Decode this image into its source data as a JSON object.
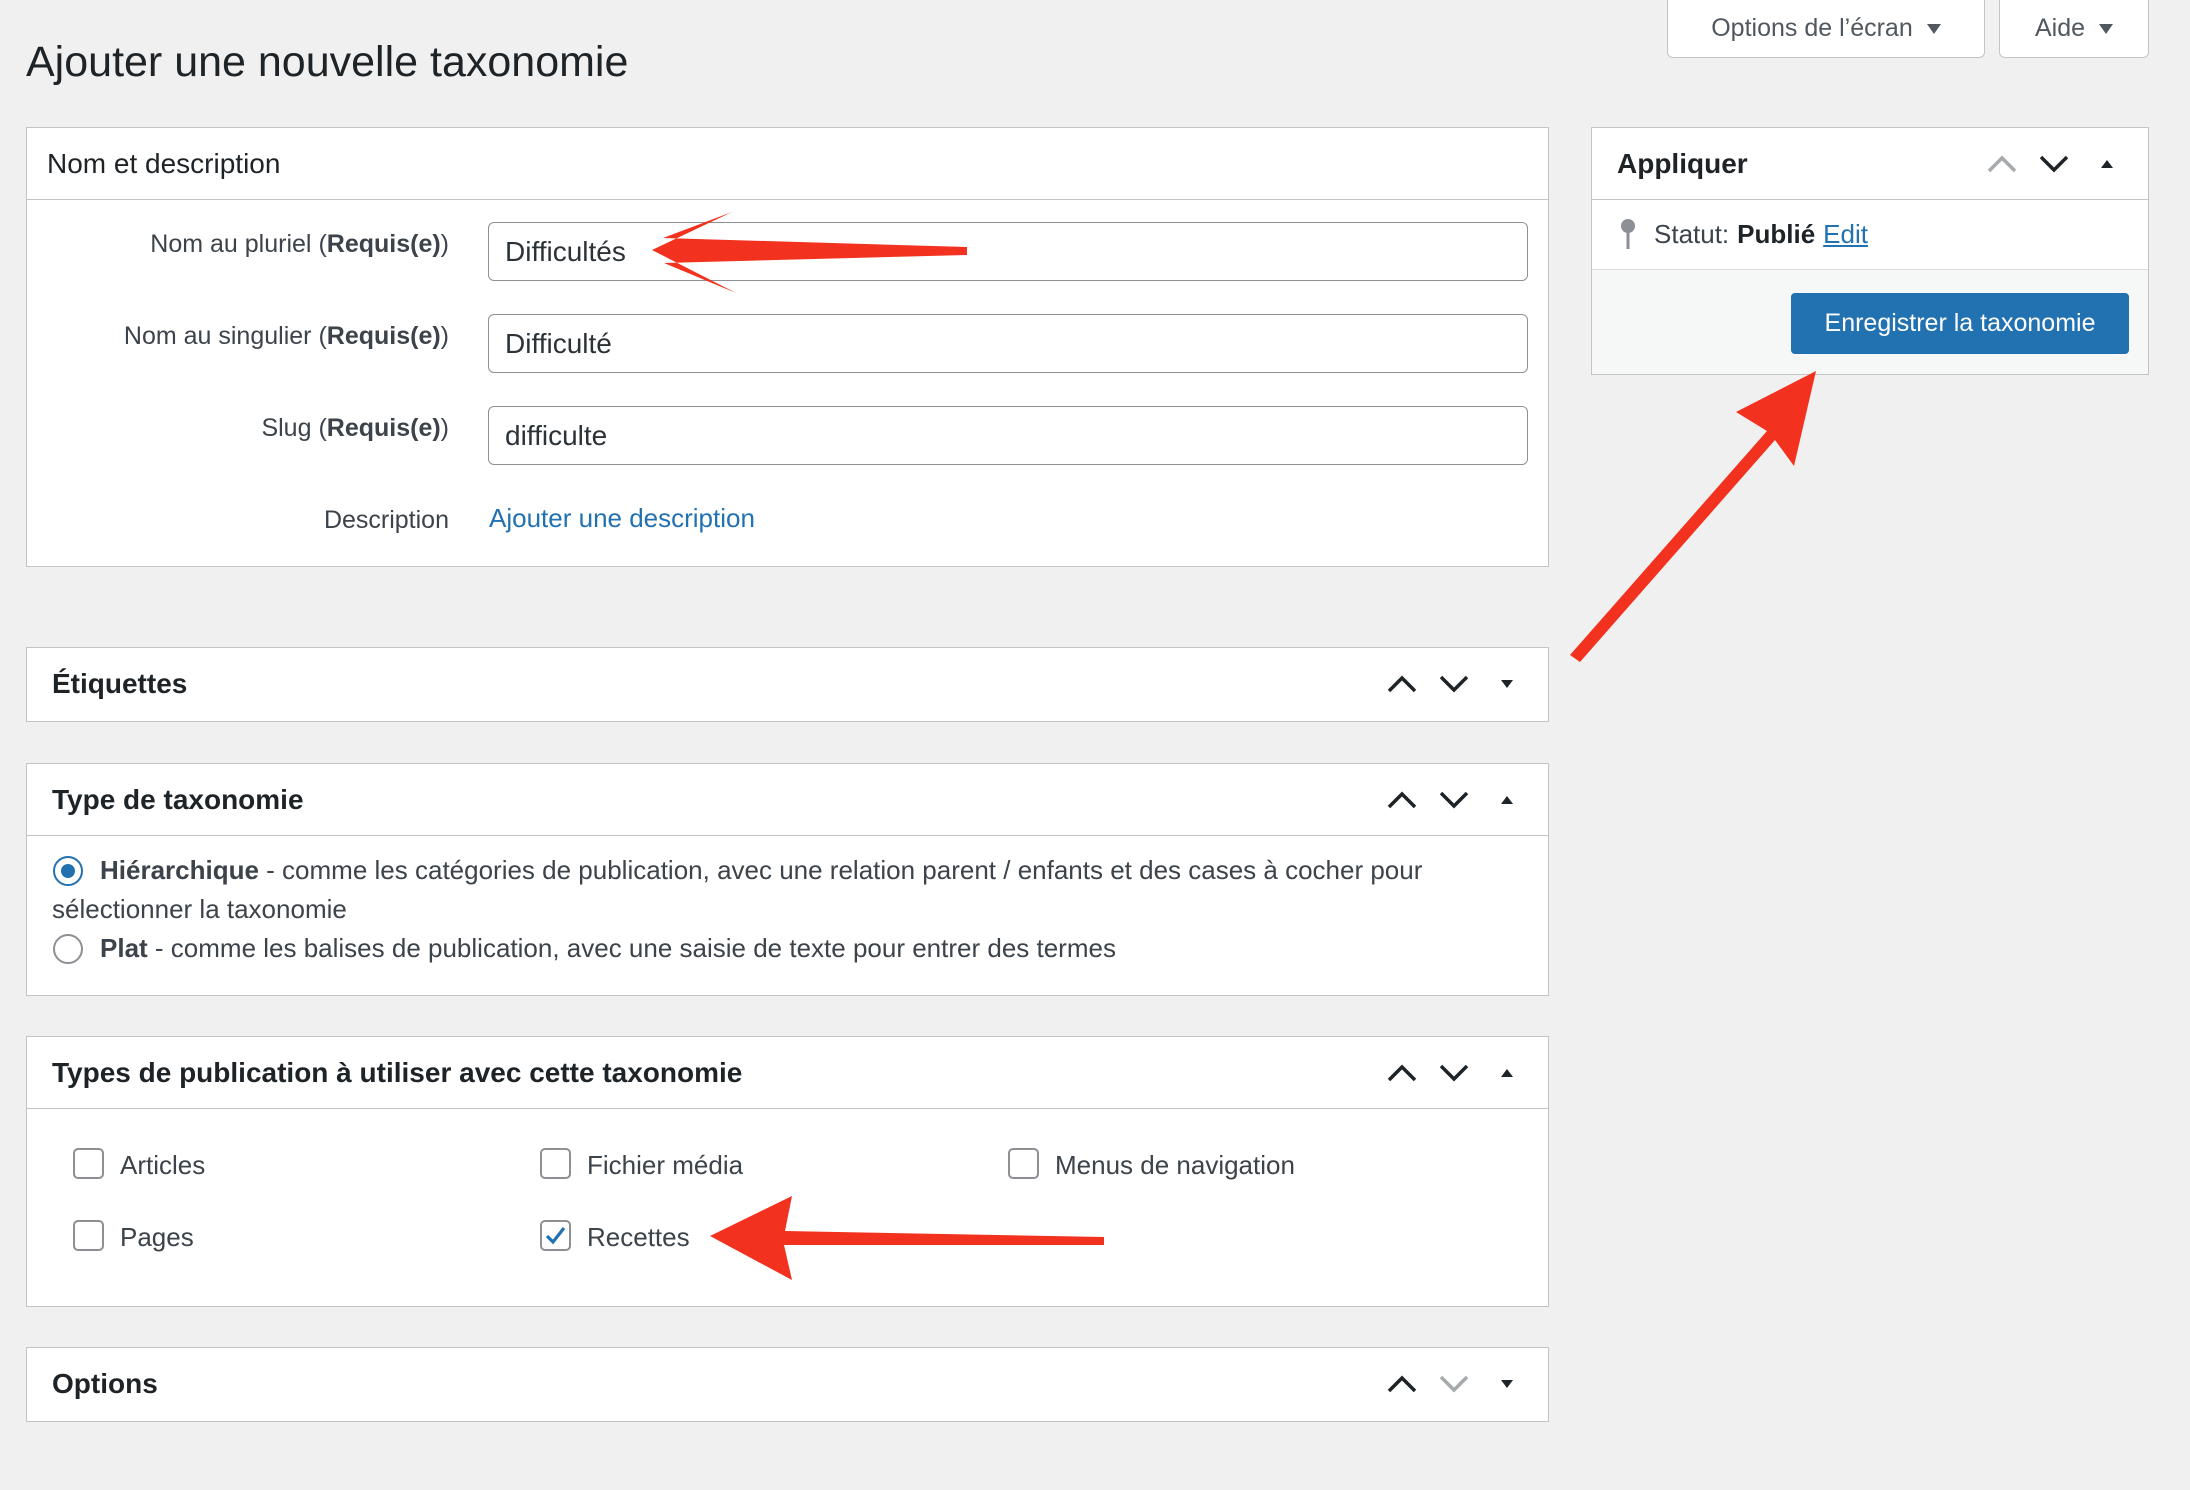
{
  "screen_meta": {
    "options_label": "Options de l’écran",
    "help_label": "Aide"
  },
  "page_title": "Ajouter une nouvelle taxonomie",
  "name_box": {
    "title": "Nom et description",
    "plural_label": "Nom au pluriel",
    "singular_label": "Nom au singulier",
    "slug_label": "Slug",
    "required_prefix": "(",
    "required_text": "Requis(e)",
    "required_suffix": ")",
    "plural_value": "Difficultés",
    "singular_value": "Difficulté",
    "slug_value": "difficulte",
    "description_label": "Description",
    "description_link": "Ajouter une description"
  },
  "labels_box": {
    "title": "Étiquettes"
  },
  "type_box": {
    "title": "Type de taxonomie",
    "hierarchical_label": "Hiérarchique",
    "hierarchical_desc": " - comme les catégories de publication, avec une relation parent / enfants et des cases à cocher pour",
    "hierarchical_desc_2": "sélectionner la taxonomie",
    "flat_label": "Plat",
    "flat_desc": " - comme les balises de publication, avec une saisie de texte pour entrer des termes",
    "selected": "hierarchical"
  },
  "post_types_box": {
    "title": "Types de publication à utiliser avec cette taxonomie",
    "items": [
      {
        "label": "Articles",
        "checked": false
      },
      {
        "label": "Fichier média",
        "checked": false
      },
      {
        "label": "Menus de navigation",
        "checked": false
      },
      {
        "label": "Pages",
        "checked": false
      },
      {
        "label": "Recettes",
        "checked": true
      }
    ]
  },
  "options_box": {
    "title": "Options"
  },
  "publish_box": {
    "title": "Appliquer",
    "status_label": "Statut:",
    "status_value": "Publié",
    "edit_link": "Edit",
    "save_button": "Enregistrer la taxonomie"
  },
  "colors": {
    "accent": "#2271b1",
    "annotation_arrow": "#f2311e",
    "background": "#f0f0f1",
    "border": "#c3c4c7"
  }
}
